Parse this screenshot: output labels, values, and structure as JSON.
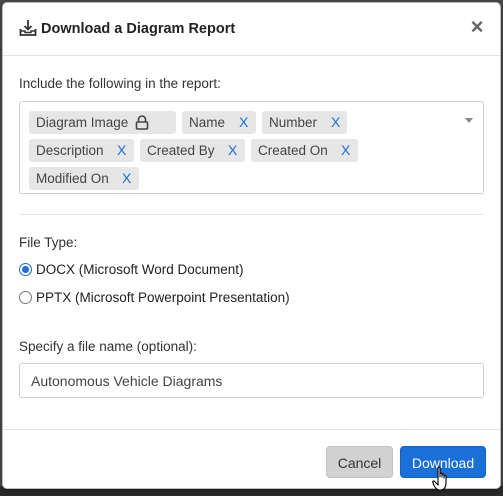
{
  "dialog": {
    "title": "Download a Diagram Report",
    "header_icon": "download-tray-icon",
    "close_label": "×"
  },
  "include": {
    "label": "Include the following in the report:",
    "tags": [
      {
        "label": "Diagram Image",
        "locked": true
      },
      {
        "label": "Name",
        "remove": "X"
      },
      {
        "label": "Number",
        "remove": "X"
      },
      {
        "label": "Description",
        "remove": "X"
      },
      {
        "label": "Created By",
        "remove": "X"
      },
      {
        "label": "Created On",
        "remove": "X"
      },
      {
        "label": "Modified On",
        "remove": "X"
      }
    ]
  },
  "file_type": {
    "label": "File Type:",
    "options": [
      {
        "label": "DOCX (Microsoft Word Document)",
        "selected": true
      },
      {
        "label": "PPTX (Microsoft Powerpoint Presentation)",
        "selected": false
      }
    ]
  },
  "file_name": {
    "label": "Specify a file name (optional):",
    "value": "Autonomous Vehicle Diagrams"
  },
  "buttons": {
    "cancel": "Cancel",
    "download": "Download"
  },
  "colors": {
    "accent": "#1a6fd8",
    "tag_bg": "#e6e6e6",
    "cancel_bg": "#d2d2d2"
  }
}
